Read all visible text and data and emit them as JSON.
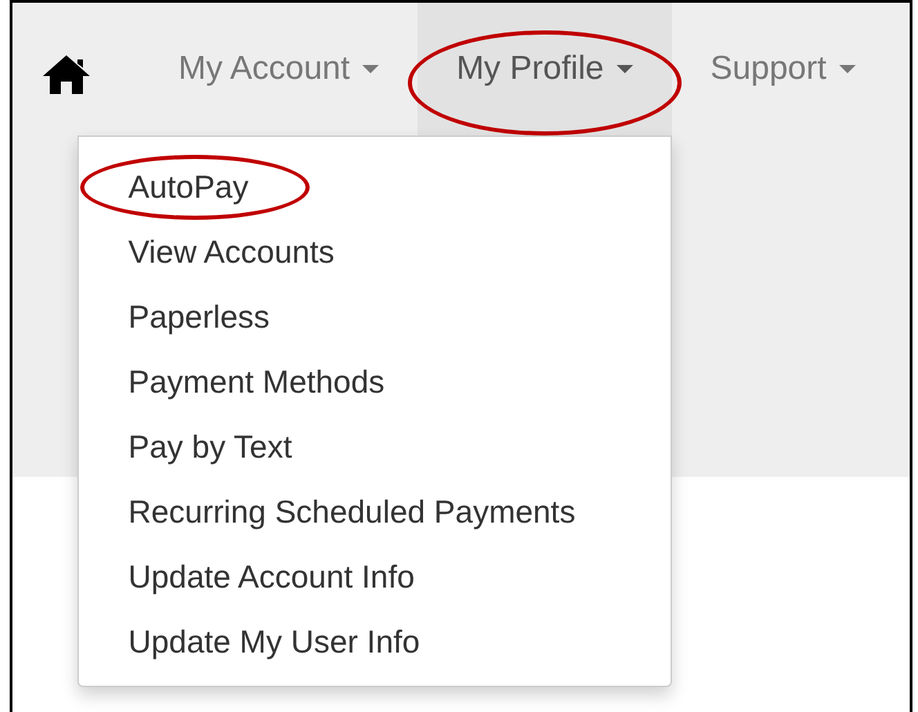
{
  "nav": {
    "items": [
      {
        "label": "My Account",
        "selected": false,
        "circled": false
      },
      {
        "label": "My Profile",
        "selected": true,
        "circled": true
      },
      {
        "label": "Support",
        "selected": false,
        "circled": false
      }
    ]
  },
  "dropdown": {
    "items": [
      {
        "label": "AutoPay",
        "circled": true
      },
      {
        "label": "View Accounts",
        "circled": false
      },
      {
        "label": "Paperless",
        "circled": false
      },
      {
        "label": "Payment Methods",
        "circled": false
      },
      {
        "label": "Pay by Text",
        "circled": false
      },
      {
        "label": "Recurring Scheduled Payments",
        "circled": false
      },
      {
        "label": "Update Account Info",
        "circled": false
      },
      {
        "label": "Update My User Info",
        "circled": false
      }
    ]
  }
}
